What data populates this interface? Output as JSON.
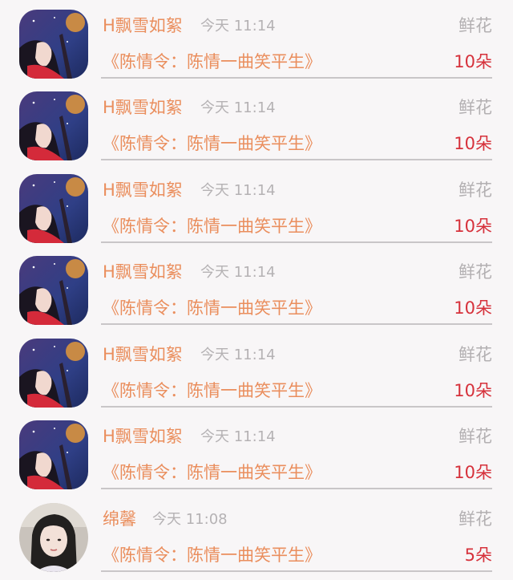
{
  "entries": [
    {
      "name": "H飘雪如絮",
      "time": "今天 11:14",
      "gift": "鲜花",
      "book": "《陈情令：陈情一曲笑平生》",
      "count": "10朵",
      "avatar": "anime-girl-avatar"
    },
    {
      "name": "H飘雪如絮",
      "time": "今天 11:14",
      "gift": "鲜花",
      "book": "《陈情令：陈情一曲笑平生》",
      "count": "10朵",
      "avatar": "anime-girl-avatar"
    },
    {
      "name": "H飘雪如絮",
      "time": "今天 11:14",
      "gift": "鲜花",
      "book": "《陈情令：陈情一曲笑平生》",
      "count": "10朵",
      "avatar": "anime-girl-avatar"
    },
    {
      "name": "H飘雪如絮",
      "time": "今天 11:14",
      "gift": "鲜花",
      "book": "《陈情令：陈情一曲笑平生》",
      "count": "10朵",
      "avatar": "anime-girl-avatar"
    },
    {
      "name": "H飘雪如絮",
      "time": "今天 11:14",
      "gift": "鲜花",
      "book": "《陈情令：陈情一曲笑平生》",
      "count": "10朵",
      "avatar": "anime-girl-avatar"
    },
    {
      "name": "H飘雪如絮",
      "time": "今天 11:14",
      "gift": "鲜花",
      "book": "《陈情令：陈情一曲笑平生》",
      "count": "10朵",
      "avatar": "anime-girl-avatar"
    },
    {
      "name": "绵馨",
      "time": "今天 11:08",
      "gift": "鲜花",
      "book": "《陈情令：陈情一曲笑平生》",
      "count": "5朵",
      "avatar": "photo-girl-avatar"
    }
  ],
  "colors": {
    "name": "#ea8e5d",
    "book": "#ea8e5d",
    "count": "#d6313b",
    "muted": "#b5b2b4",
    "background": "#f8f6f7"
  }
}
